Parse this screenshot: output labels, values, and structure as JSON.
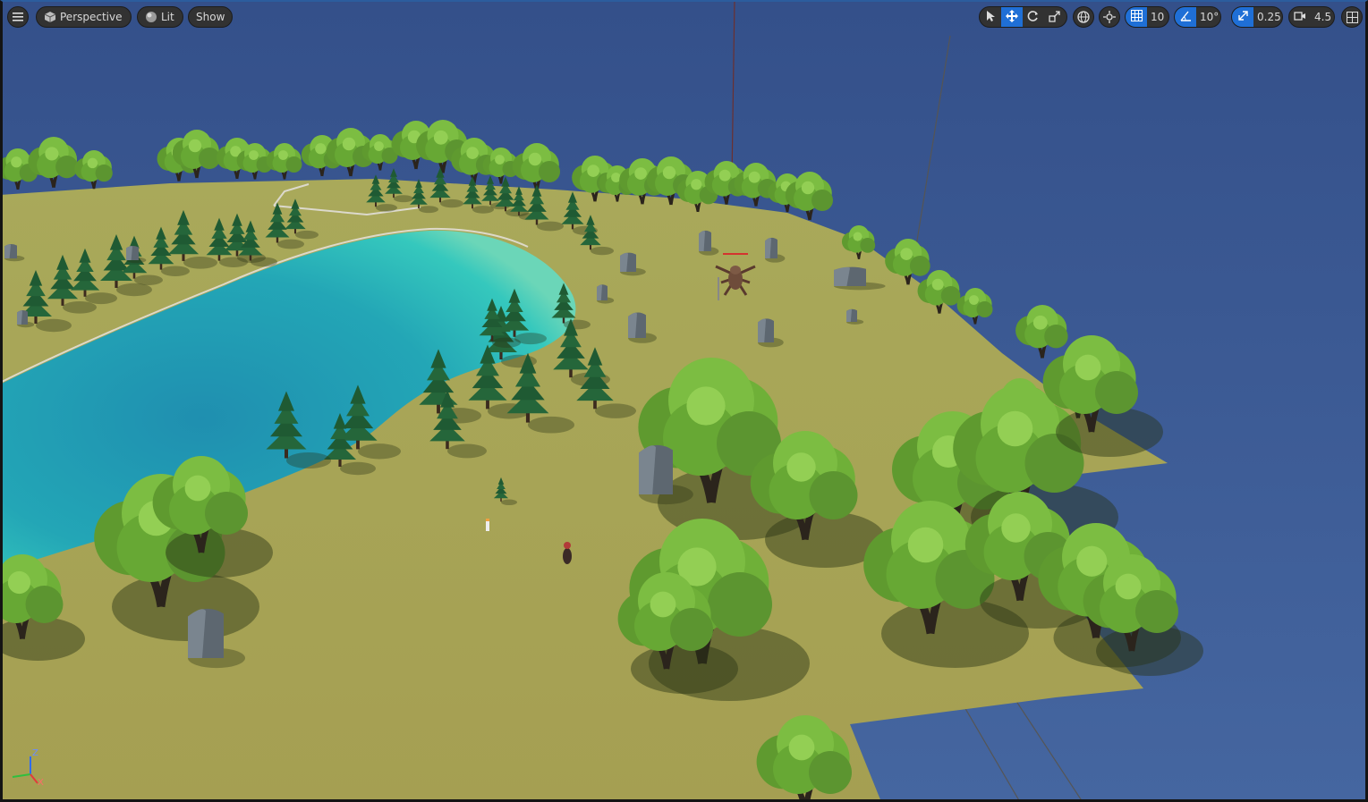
{
  "toolbar": {
    "menu_icon": "hamburger-icon",
    "view_mode": "Perspective",
    "view_mode_icon": "cube-icon",
    "lighting": "Lit",
    "lighting_icon": "sphere-icon",
    "show_label": "Show",
    "grid_snap_value": "10",
    "rotation_snap_value": "10°",
    "scale_snap_value": "0.25",
    "camera_speed_value": "4.5"
  },
  "colors": {
    "accent": "#1f6fd6",
    "toolbar_bg": "#323232",
    "sky": "#3e5a8c",
    "grass": "#a7a655",
    "water": "#2fb4b6"
  },
  "axis": {
    "z": "Z",
    "x": "X"
  }
}
